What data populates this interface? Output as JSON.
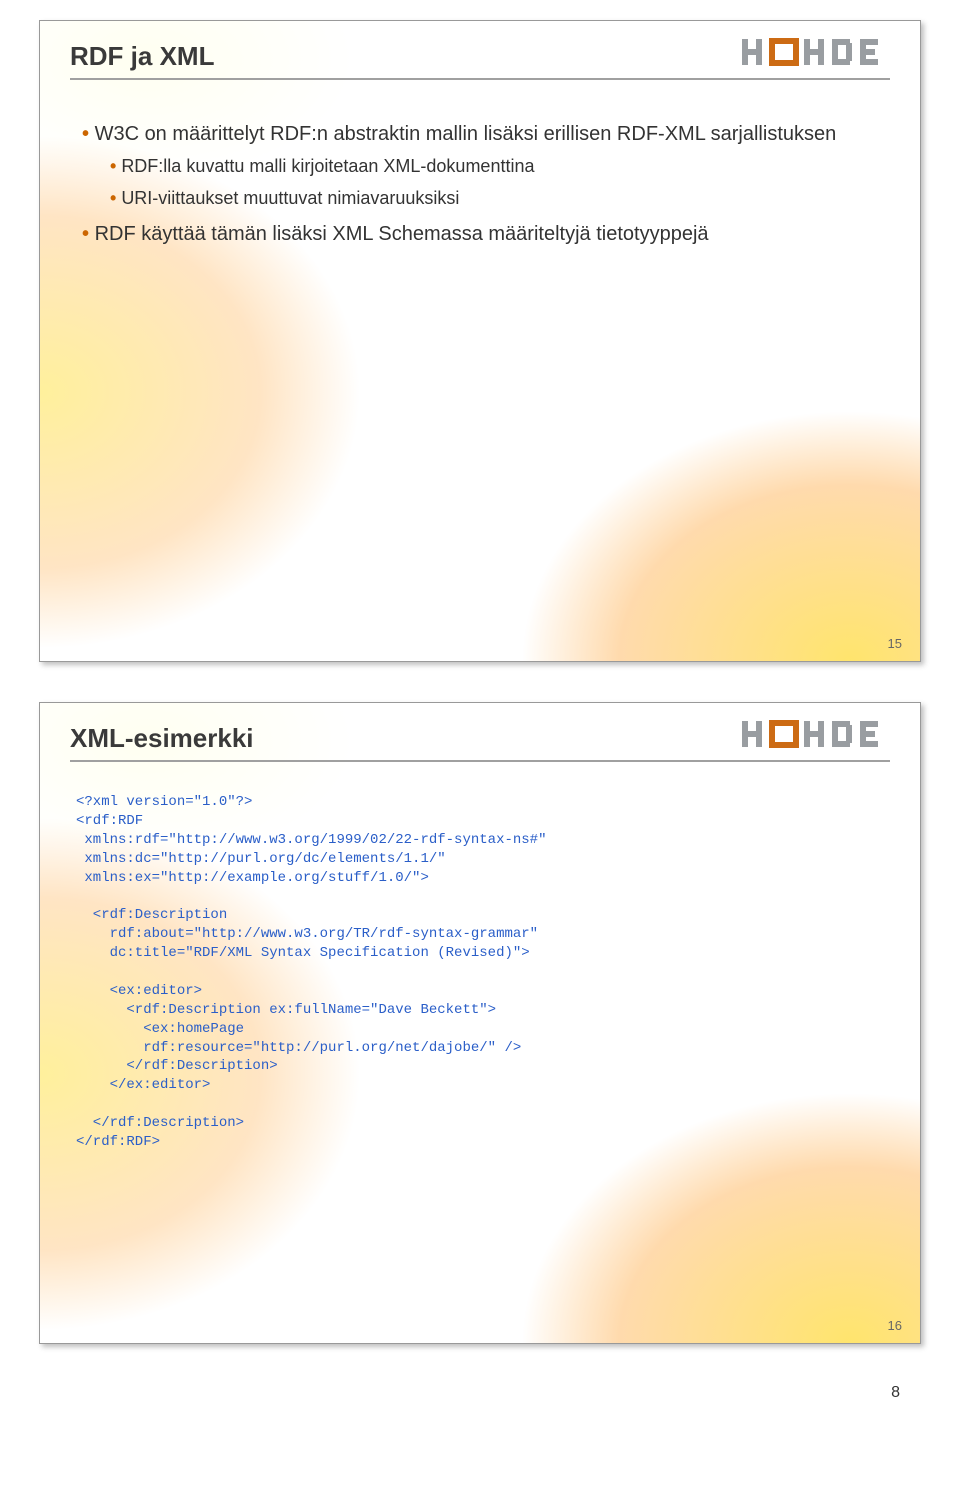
{
  "slide1": {
    "title": "RDF ja XML",
    "bullets": [
      {
        "text": "W3C on määrittelyt RDF:n abstraktin mallin lisäksi erillisen RDF-XML sarjallistuksen",
        "sub": [
          "RDF:lla kuvattu malli kirjoitetaan XML-dokumenttina",
          "URI-viittaukset muuttuvat nimiavaruuksiksi"
        ]
      },
      {
        "text": "RDF käyttää tämän lisäksi XML Schemassa määriteltyjä tietotyyppejä",
        "sub": []
      }
    ],
    "num": "15"
  },
  "slide2": {
    "title": "XML-esimerkki",
    "code": "<?xml version=\"1.0\"?>\n<rdf:RDF\n xmlns:rdf=\"http://www.w3.org/1999/02/22-rdf-syntax-ns#\"\n xmlns:dc=\"http://purl.org/dc/elements/1.1/\"\n xmlns:ex=\"http://example.org/stuff/1.0/\">\n\n  <rdf:Description\n    rdf:about=\"http://www.w3.org/TR/rdf-syntax-grammar\"\n    dc:title=\"RDF/XML Syntax Specification (Revised)\">\n\n    <ex:editor>\n      <rdf:Description ex:fullName=\"Dave Beckett\">\n        <ex:homePage\n        rdf:resource=\"http://purl.org/net/dajobe/\" />\n      </rdf:Description>\n    </ex:editor>\n\n  </rdf:Description>\n</rdf:RDF>",
    "num": "16"
  },
  "pageNumber": "8",
  "colors": {
    "bullet": "#cc6600",
    "code": "#2a5ec8",
    "logoGray": "#999da1",
    "logoOrange": "#cc6b14"
  }
}
